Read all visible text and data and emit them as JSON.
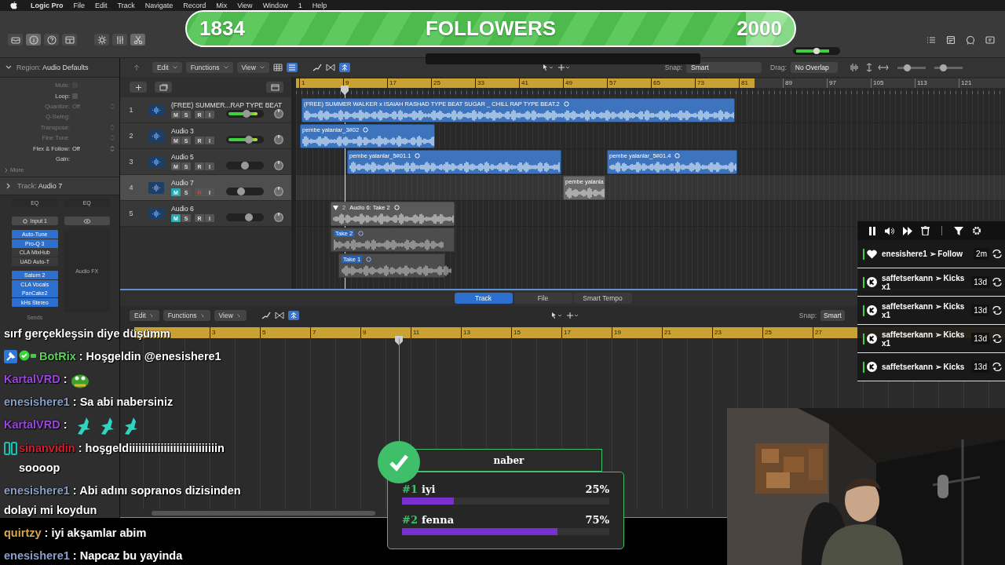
{
  "menu_bar": {
    "app": "Logic Pro",
    "items": [
      "File",
      "Edit",
      "Track",
      "Navigate",
      "Record",
      "Mix",
      "View",
      "Window",
      "1",
      "Help"
    ]
  },
  "control_bar": {
    "master_volume": {
      "level": 0.5
    },
    "left_buttons": [
      {
        "kind": "library",
        "selected": false
      },
      {
        "kind": "info",
        "selected": true
      },
      {
        "kind": "help",
        "selected": false
      },
      {
        "kind": "notes",
        "selected": false
      },
      {
        "kind": "tuner",
        "selected": false
      },
      {
        "kind": "mixer",
        "selected": false
      },
      {
        "kind": "editors",
        "selected": true
      }
    ],
    "right_buttons": [
      {
        "kind": "list"
      },
      {
        "kind": "notepad"
      },
      {
        "kind": "loops"
      },
      {
        "kind": "browser"
      }
    ]
  },
  "follower_goal": {
    "current": "1834",
    "label": "FOLLOWERS",
    "target": "2000",
    "level": 0.92
  },
  "region_inspector": {
    "label": "Region:",
    "title": "Audio Defaults",
    "fields": [
      {
        "label": "Mute:",
        "kind": "checkbox",
        "checked": false,
        "disabled": true
      },
      {
        "label": "Loop:",
        "kind": "checkbox",
        "checked": false,
        "disabled": false
      },
      {
        "label": "Quantize:",
        "value": "Off",
        "kind": "popup",
        "disabled": true
      },
      {
        "label": "Q-Swing:",
        "kind": "text",
        "disabled": true
      },
      {
        "label": "Transpose:",
        "kind": "popup",
        "disabled": true
      },
      {
        "label": "Fine Tune:",
        "kind": "popup",
        "disabled": true
      },
      {
        "label": "Flex & Follow:",
        "value": "Off",
        "kind": "popup",
        "disabled": false
      },
      {
        "label": "Gain:",
        "kind": "text",
        "disabled": false
      }
    ],
    "more": "More"
  },
  "track_inspector": {
    "label": "Track:",
    "title": "Audio 7"
  },
  "channel_strips": [
    {
      "eq": "EQ",
      "input": "Input 1",
      "plugin_groups": [
        [
          {
            "name": "Auto-Tune",
            "on": true
          },
          {
            "name": "Pro-Q 3",
            "on": true
          },
          {
            "name": "CLA MixHub",
            "on": false
          },
          {
            "name": "UAD Auto-T",
            "on": false
          }
        ],
        [
          {
            "name": "Saturn 2",
            "on": true
          },
          {
            "name": "CLA Vocals",
            "on": true
          },
          {
            "name": "PanCake2",
            "on": true
          },
          {
            "name": "kHs Stereo",
            "on": true
          }
        ]
      ],
      "sends": "Sends"
    },
    {
      "eq": "EQ",
      "fx": "Audio FX"
    }
  ],
  "tracks_toolbar": {
    "menus": [
      "Edit",
      "Functions",
      "View"
    ],
    "snap_label": "Snap:",
    "snap": "Smart",
    "drag_label": "Drag:",
    "drag": "No Overlap",
    "zoom_sliders": [
      {
        "level": 0.35
      },
      {
        "level": 0.3
      }
    ]
  },
  "ruler": [
    "1",
    "9",
    "17",
    "25",
    "33",
    "41",
    "49",
    "57",
    "65",
    "73",
    "81",
    "89",
    "97",
    "105",
    "113",
    "121"
  ],
  "tracks": [
    {
      "number": "1",
      "name": "(FREE) SUMMER...RAP TYPE BEAT",
      "selected": false,
      "buttons": [
        {
          "kind": "mute",
          "label": "M",
          "on": false
        },
        {
          "kind": "solo",
          "label": "S",
          "on": false
        },
        {
          "kind": "record",
          "label": "R",
          "on": false
        },
        {
          "kind": "input",
          "label": "I",
          "on": false
        }
      ],
      "signal": true,
      "level": 0.55,
      "regions": [
        {
          "kind": "audio",
          "name": "(FREE) SUMMER WALKER x ISAIAH RASHAD TYPE BEAT SUGAR _ CHILL RAP TYPE BEAT.2"
        }
      ]
    },
    {
      "number": "2",
      "name": "Audio 3",
      "selected": false,
      "buttons": [
        {
          "kind": "mute",
          "label": "M",
          "on": false
        },
        {
          "kind": "solo",
          "label": "S",
          "on": false
        },
        {
          "kind": "record",
          "label": "R",
          "on": false
        },
        {
          "kind": "input",
          "label": "I",
          "on": false
        }
      ],
      "signal": true,
      "level": 0.6,
      "regions": [
        {
          "kind": "audio",
          "name": "pembe yalanlar_3#02"
        }
      ]
    },
    {
      "number": "3",
      "name": "Audio 5",
      "selected": false,
      "buttons": [
        {
          "kind": "mute",
          "label": "M",
          "on": false
        },
        {
          "kind": "solo",
          "label": "S",
          "on": false
        },
        {
          "kind": "record",
          "label": "R",
          "on": false
        },
        {
          "kind": "input",
          "label": "I",
          "on": false
        }
      ],
      "signal": false,
      "level": 0.5,
      "regions": [
        {
          "kind": "audio",
          "name": "pembe yalanlar_5#01.1"
        },
        {
          "kind": "audio",
          "name": "pembe yalanlar_5#01.4"
        }
      ]
    },
    {
      "number": "4",
      "name": "Audio 7",
      "selected": true,
      "buttons": [
        {
          "kind": "mute",
          "label": "M",
          "on": true
        },
        {
          "kind": "solo",
          "label": "S",
          "on": false
        },
        {
          "kind": "record",
          "label": "R",
          "on": true
        },
        {
          "kind": "input",
          "label": "I",
          "on": false
        }
      ],
      "signal": false,
      "level": 0.4,
      "regions": [
        {
          "kind": "audio",
          "name": "pembe yalanla"
        }
      ]
    },
    {
      "number": "5",
      "name": "Audio 6",
      "selected": false,
      "buttons": [
        {
          "kind": "mute",
          "label": "M",
          "on": true
        },
        {
          "kind": "solo",
          "label": "S",
          "on": false
        },
        {
          "kind": "record",
          "label": "R",
          "on": false
        },
        {
          "kind": "input",
          "label": "I",
          "on": false
        }
      ],
      "signal": false,
      "level": 0.6,
      "regions": [
        {
          "kind": "take_folder",
          "take_count": "2",
          "name": "Audio 6: Take 2",
          "takes": [
            {
              "name": "Take 2"
            },
            {
              "name": "Take 1"
            }
          ]
        }
      ]
    }
  ],
  "editor": {
    "tabs": [
      {
        "label": "Track",
        "selected": true
      },
      {
        "label": "File",
        "selected": false
      },
      {
        "label": "Smart Tempo",
        "selected": false
      }
    ],
    "menus": [
      "Edit",
      "Functions",
      "View"
    ],
    "snap_label": "Snap:",
    "snap": "Smart",
    "ruler": [
      "3",
      "5",
      "7",
      "9",
      "11",
      "13",
      "15",
      "17",
      "19",
      "21",
      "23",
      "25",
      "27"
    ]
  },
  "alerts": {
    "items": [
      {
        "kind": "follow",
        "text": "enesishere1 ➢ Follow",
        "time": "2m"
      },
      {
        "kind": "kicks",
        "text": "saffetserkann ➢ Kicks x1",
        "time": "13d"
      },
      {
        "kind": "kicks",
        "text": "saffetserkann ➢ Kicks x1",
        "time": "13d"
      },
      {
        "kind": "kicks",
        "text": "saffetserkann ➢ Kicks x1",
        "time": "13d"
      },
      {
        "kind": "kicks",
        "text": "saffetserkann ➢ Kicks",
        "time": "13d"
      }
    ]
  },
  "chat": [
    {
      "text": "sırf gerçekleşsin diye düşümm"
    },
    {
      "badges": [
        {
          "kind": "moderator"
        },
        {
          "kind": "verified"
        }
      ],
      "user": "BotRix",
      "color": "#5bd35b",
      "text": ": Hoşgeldin @enesishere1"
    },
    {
      "user": "KartalVRD",
      "color": "#9b45e0",
      "text": ":",
      "emotes": [
        {
          "kind": "frog"
        }
      ]
    },
    {
      "user": "enesishere1",
      "color": "#8aa0c6",
      "text": ": Sa abi nabersiniz"
    },
    {
      "user": "KartalVRD",
      "color": "#9b45e0",
      "text": ":",
      "emotes": [
        {
          "kind": "bird"
        },
        {
          "kind": "bird"
        },
        {
          "kind": "bird"
        }
      ]
    },
    {
      "badges": [
        {
          "kind": "og"
        }
      ],
      "user": "sinanvidin",
      "color": "#d41c2c",
      "text": ": hoşgeldiiiiiiiiiiiiiiiiiiiiiiiiiiiin soooop"
    },
    {
      "user": "enesishere1",
      "color": "#8aa0c6",
      "text": ": Abi adını sopranos dizisinden dolayi mi koydun"
    },
    {
      "user": "quirtzy",
      "color": "#d6a84a",
      "text": ": iyi akşamlar abim"
    },
    {
      "user": "enesishere1",
      "color": "#8aa0c6",
      "text": ": Napcaz bu yayinda"
    }
  ],
  "poll": {
    "title": "naber",
    "options": [
      {
        "rank": "#1",
        "label": "iyi",
        "percent": "25%",
        "level": 0.25
      },
      {
        "rank": "#2",
        "label": "fenna",
        "percent": "75%",
        "level": 0.75
      }
    ]
  }
}
